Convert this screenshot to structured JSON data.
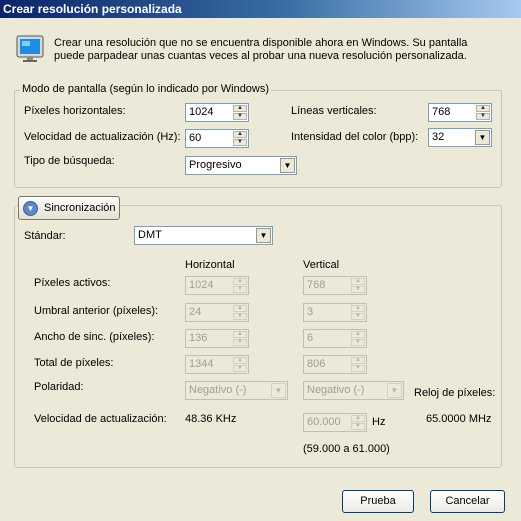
{
  "window": {
    "title": "Crear resolución personalizada"
  },
  "intro": {
    "icon": "monitor-icon",
    "line1": "Crear una resolución que no se encuentra disponible ahora en Windows. Su pantalla",
    "line2": "puede parpadear unas cuantas veces al probar una nueva resolución personalizada."
  },
  "display_mode": {
    "legend": "Modo de pantalla (según lo indicado por Windows)",
    "h_pixels_label": "Píxeles horizontales:",
    "h_pixels_value": "1024",
    "v_lines_label": "Líneas verticales:",
    "v_lines_value": "768",
    "refresh_label": "Velocidad de actualización (Hz):",
    "refresh_value": "60",
    "color_label": "Intensidad del color (bpp):",
    "color_value": "32",
    "scan_label": "Tipo de búsqueda:",
    "scan_value": "Progresivo"
  },
  "sync": {
    "button_label": "Sincronización",
    "standard_label": "Stándar:",
    "standard_value": "DMT",
    "col_horizontal": "Horizontal",
    "col_vertical": "Vertical",
    "rows": {
      "active_label": "Píxeles activos:",
      "active_h": "1024",
      "active_v": "768",
      "front_label": "Umbral anterior (píxeles):",
      "front_h": "24",
      "front_v": "3",
      "width_label": "Ancho de sinc. (píxeles):",
      "width_h": "136",
      "width_v": "6",
      "total_label": "Total de píxeles:",
      "total_h": "1344",
      "total_v": "806",
      "polarity_label": "Polaridad:",
      "polarity_h": "Negativo (-)",
      "polarity_v": "Negativo (-)"
    },
    "pixel_clock_label": "Reloj de píxeles:",
    "pixel_clock_value": "65.0000 MHz",
    "refresh_label": "Velocidad de actualización:",
    "refresh_h": "48.36 KHz",
    "refresh_v": "60.000",
    "refresh_v_unit": "Hz",
    "refresh_range": "(59.000 a 61.000)"
  },
  "buttons": {
    "test": "Prueba",
    "cancel": "Cancelar"
  }
}
